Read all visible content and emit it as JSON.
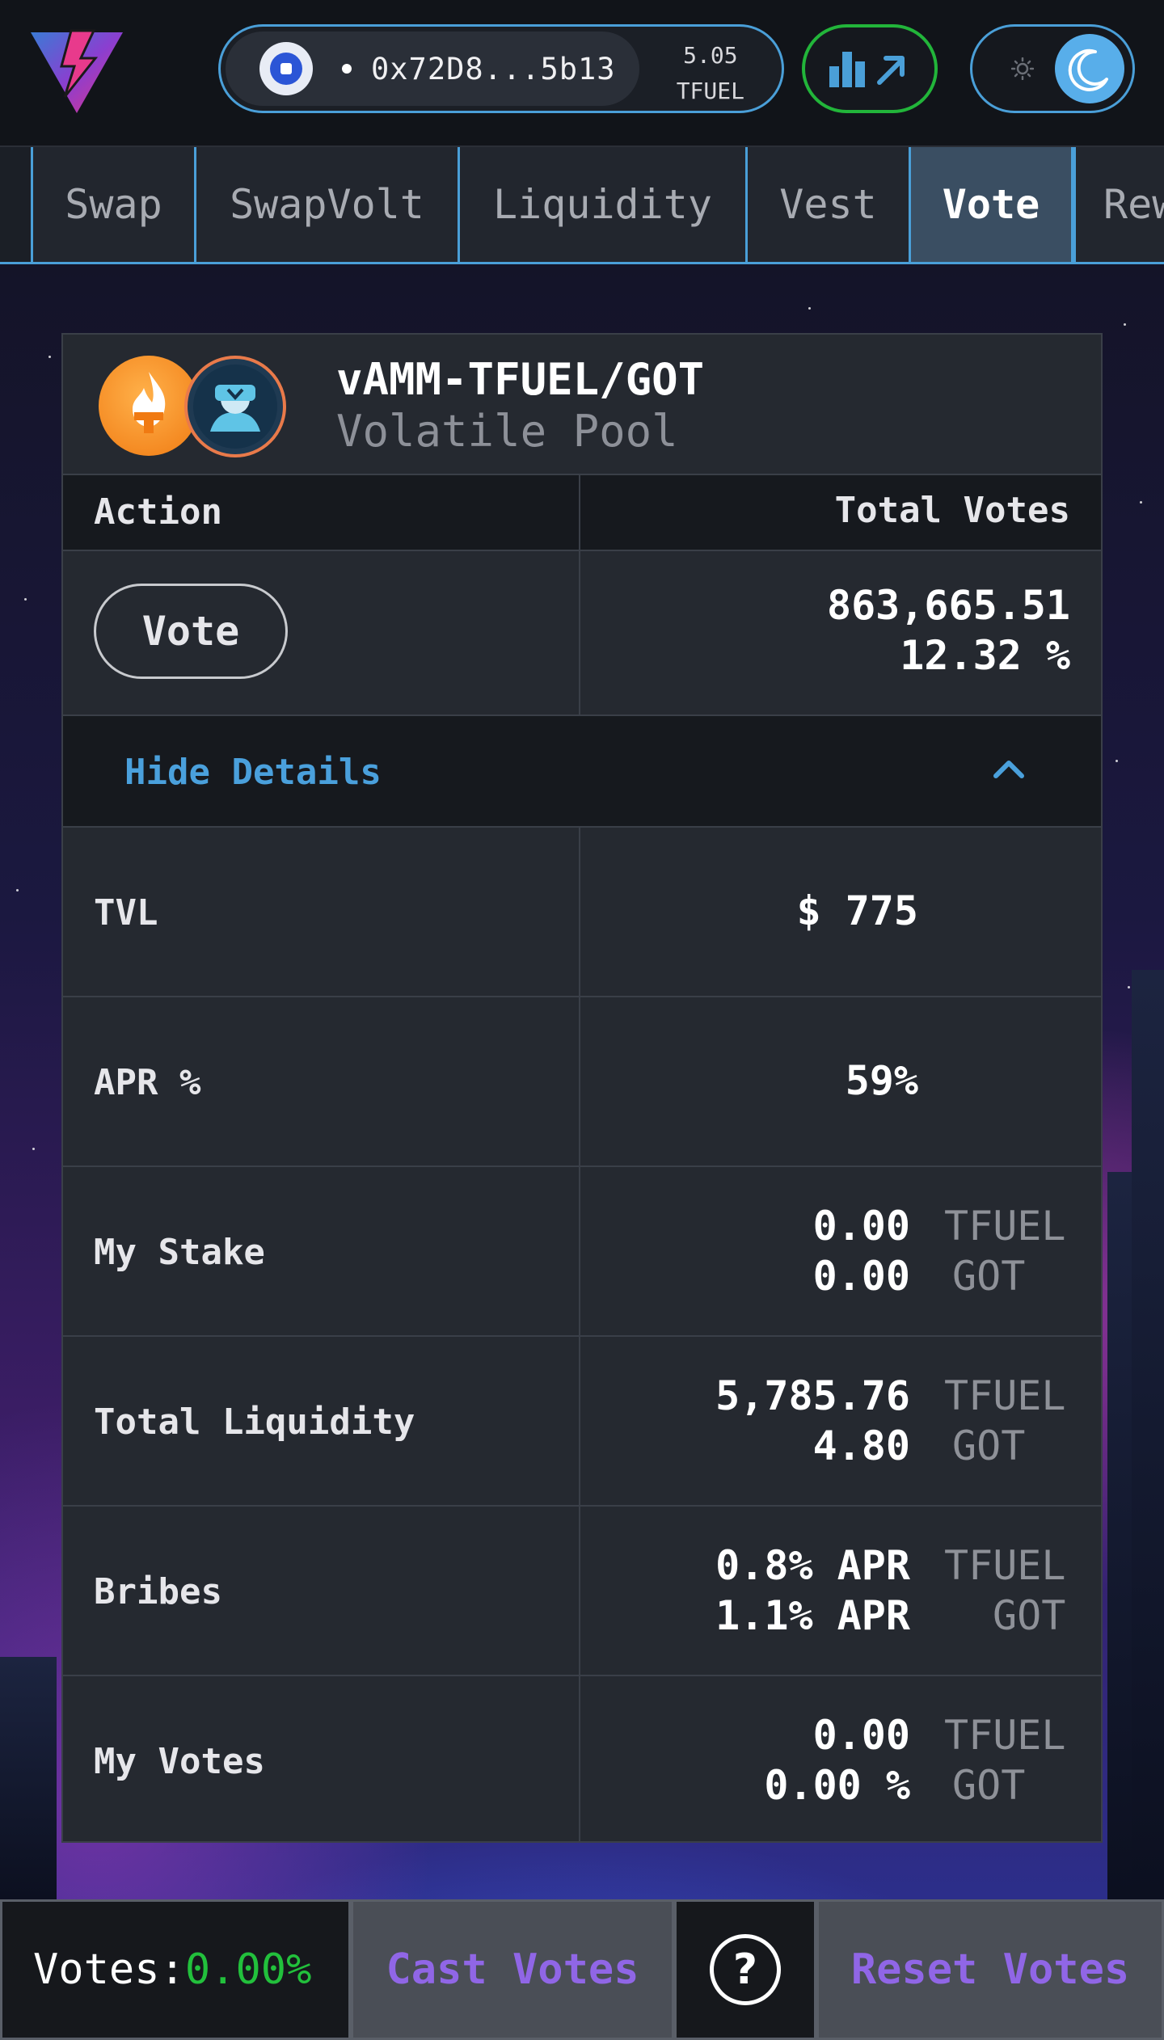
{
  "header": {
    "wallet_address": "0x72D8...5b13",
    "balance_amount": "5.05",
    "balance_unit": "TFUEL"
  },
  "tabs": [
    {
      "label": "Swap",
      "active": false
    },
    {
      "label": "SwapVolt",
      "active": false
    },
    {
      "label": "Liquidity",
      "active": false
    },
    {
      "label": "Vest",
      "active": false
    },
    {
      "label": "Vote",
      "active": true
    },
    {
      "label": "Rew",
      "active": false
    }
  ],
  "pool": {
    "name": "vAMM-TFUEL/GOT",
    "type": "Volatile Pool",
    "token_icons": [
      "tfuel-token-icon",
      "got-token-icon"
    ]
  },
  "table": {
    "action_header": "Action",
    "votes_header": "Total Votes",
    "vote_button": "Vote",
    "total_votes": "863,665.51",
    "total_votes_pct": "12.32 %",
    "details_toggle": "Hide Details"
  },
  "details": {
    "tvl": {
      "label": "TVL",
      "value": "$ 775"
    },
    "apr": {
      "label": "APR %",
      "value": "59%"
    },
    "my_stake": {
      "label": "My Stake",
      "v1": "0.00",
      "u1": "TFUEL",
      "v2": "0.00",
      "u2": "GOT"
    },
    "total_liquidity": {
      "label": "Total Liquidity",
      "v1": "5,785.76",
      "u1": "TFUEL",
      "v2": "4.80",
      "u2": "GOT"
    },
    "bribes": {
      "label": "Bribes",
      "v1": "0.8% APR",
      "u1": "TFUEL",
      "v2": "1.1% APR",
      "u2": "GOT"
    },
    "my_votes": {
      "label": "My Votes",
      "v1": "0.00",
      "u1": "TFUEL",
      "v2": "0.00 %",
      "u2": "GOT"
    }
  },
  "footer": {
    "votes_label": "Votes:",
    "votes_pct": "0.00%",
    "cast_votes": "Cast Votes",
    "help": "?",
    "reset_votes": "Reset Votes"
  },
  "colors": {
    "accent_blue": "#4a9fd8",
    "green": "#22b53a",
    "purple": "#9066e6"
  }
}
